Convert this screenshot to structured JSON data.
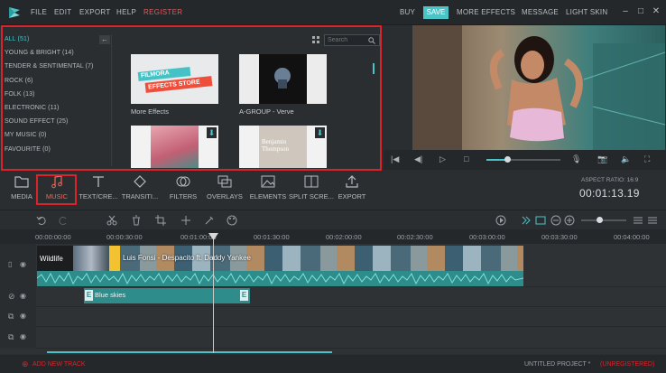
{
  "menubar": {
    "items": [
      "FILE",
      "EDIT",
      "EXPORT",
      "HELP",
      "REGISTER"
    ],
    "right": {
      "buy": "BUY",
      "save": "SAVE",
      "more_effects": "MORE EFFECTS",
      "message": "MESSAGE",
      "light_skin": "LIGHT SKIN"
    }
  },
  "library": {
    "categories": [
      "ALL (51)",
      "YOUNG & BRIGHT (14)",
      "TENDER & SENTIMENTAL (7)",
      "ROCK (6)",
      "FOLK (13)",
      "ELECTRONIC (11)",
      "SOUND EFFECT (25)",
      "MY MUSIC (0)",
      "FAVOURITE (0)"
    ],
    "search_placeholder": "Search",
    "items": [
      {
        "label": "More Effects",
        "banner_line1": "FILMORA",
        "banner_line2": "EFFECTS STORE"
      },
      {
        "label": "A-GROUP - Verve"
      },
      {
        "label": ""
      },
      {
        "label": "",
        "thumb_text": "Benjamin Thompson"
      }
    ]
  },
  "toolbar": {
    "items": [
      "MEDIA",
      "MUSIC",
      "TEXT/CRE...",
      "TRANSITI...",
      "FILTERS",
      "OVERLAYS",
      "ELEMENTS",
      "SPLIT SCRE...",
      "EXPORT"
    ],
    "aspect_ratio": "ASPECT RATIO: 16:9",
    "timecode": "00:01:13.19"
  },
  "ruler": [
    "00:00:00:00",
    "00:00:30:00",
    "00:01:00:00",
    "00:01:30:00",
    "00:02:00:00",
    "00:02:30:00",
    "00:03:00:00",
    "00:03:30:00",
    "00:04:00:00"
  ],
  "timeline": {
    "video_clip_1": "Wildlife",
    "video_clip_2": "Luis Fonsi - Despacito ft. Daddy Yankee",
    "audio_clip": "Blue skies",
    "audio_clip_tag": "E"
  },
  "bottom": {
    "add_track": "ADD NEW TRACK",
    "project_name": "UNTITLED PROJECT *",
    "project_status": "(UNREGISTERED)"
  },
  "colors": {
    "accent": "#4bc4c8",
    "highlight": "#d8242a",
    "wave": "#3aa7a6"
  }
}
